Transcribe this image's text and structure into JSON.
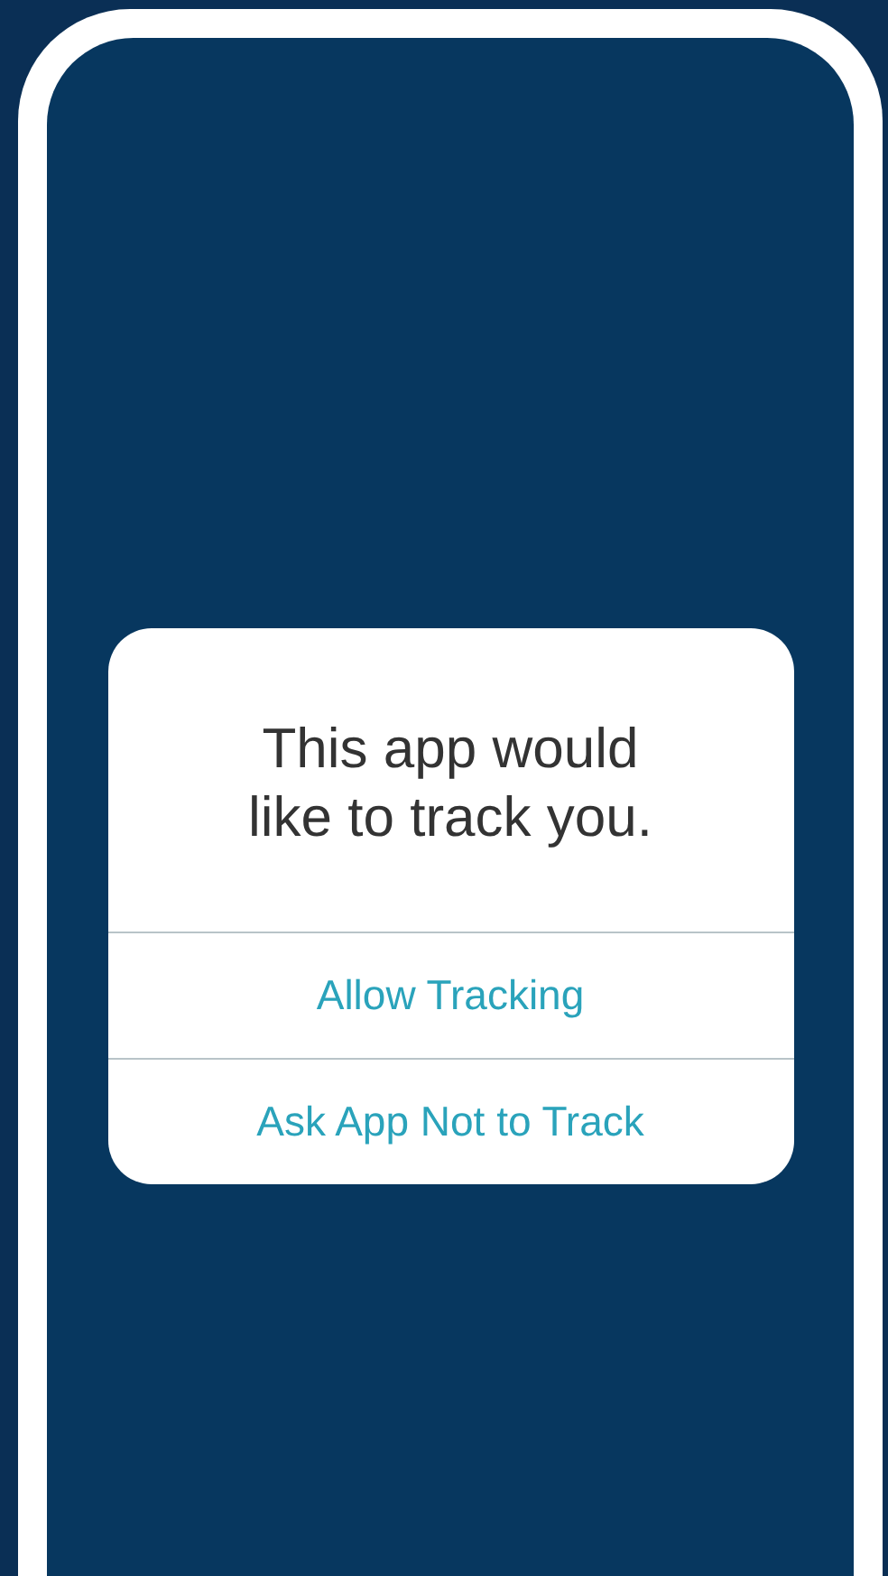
{
  "dialog": {
    "title": "This app would like to track you.",
    "buttons": [
      {
        "label": "Allow Tracking"
      },
      {
        "label": "Ask App Not to Track"
      }
    ]
  }
}
